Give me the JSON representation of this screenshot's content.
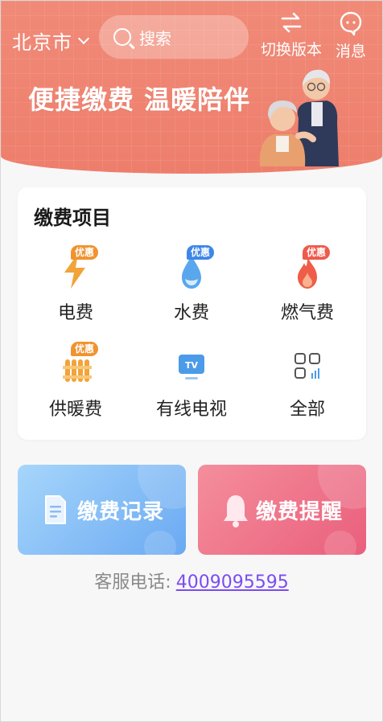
{
  "header": {
    "city": "北京市",
    "search_placeholder": "搜索",
    "switch_label": "切换版本",
    "message_label": "消息",
    "slogan": "便捷缴费 温暖陪伴"
  },
  "payments": {
    "title": "缴费项目",
    "items": [
      {
        "label": "电费",
        "icon": "lightning-icon",
        "badge": "优惠"
      },
      {
        "label": "水费",
        "icon": "water-drop-icon",
        "badge": "优惠"
      },
      {
        "label": "燃气费",
        "icon": "flame-icon",
        "badge": "优惠"
      },
      {
        "label": "供暖费",
        "icon": "radiator-icon",
        "badge": "优惠"
      },
      {
        "label": "有线电视",
        "icon": "tv-icon"
      },
      {
        "label": "全部",
        "icon": "grid-apps-icon"
      }
    ]
  },
  "actions": {
    "record_label": "缴费记录",
    "remind_label": "缴费提醒"
  },
  "service": {
    "label": "客服电话:",
    "phone": "4009095595"
  },
  "colors": {
    "header": "#ef8473",
    "badge_orange": "#f0932f",
    "badge_blue": "#3f86e8",
    "badge_red": "#ee5a4c",
    "link": "#7b4cf0"
  }
}
